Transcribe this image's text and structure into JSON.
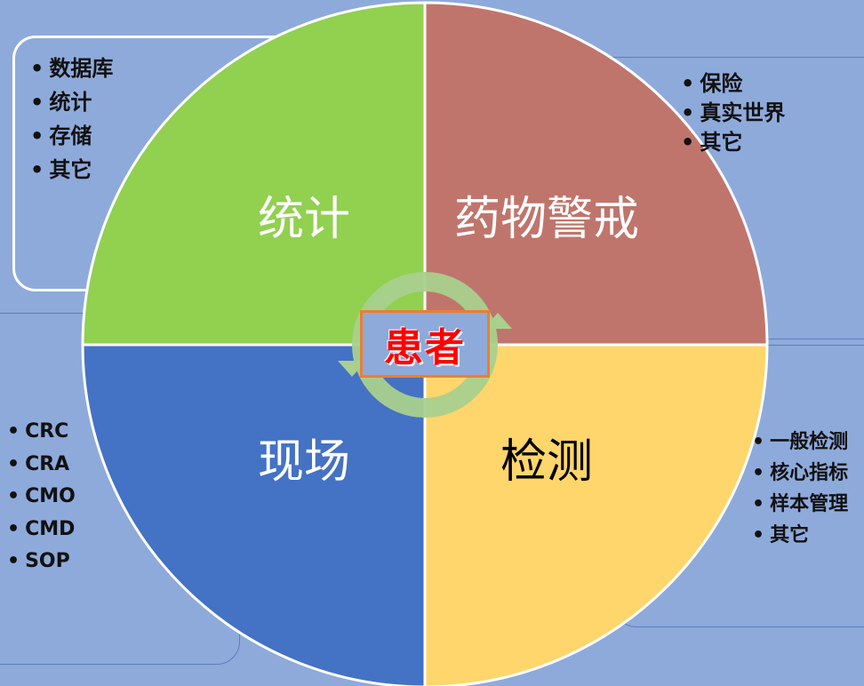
{
  "center": {
    "label": "患者"
  },
  "quadrants": [
    {
      "id": "tl",
      "label": "统计",
      "color": "#92d050",
      "text_color": "#ffffff",
      "items": [
        "数据库",
        "统计",
        "存储",
        "其它"
      ]
    },
    {
      "id": "tr",
      "label": "药物警戒",
      "color": "#c0756c",
      "text_color": "#ffffff",
      "items": [
        "保险",
        "真实世界",
        "其它"
      ]
    },
    {
      "id": "bl",
      "label": "现场",
      "color": "#4472c4",
      "text_color": "#ffffff",
      "items": [
        "CRC",
        "CRA",
        "CMO",
        "CMD",
        "SOP"
      ]
    },
    {
      "id": "br",
      "label": "检测",
      "color": "#ffd66b",
      "text_color": "#000000",
      "items": [
        "一般检测",
        "核心指标",
        "样本管理",
        "其它"
      ]
    }
  ],
  "colors": {
    "background": "#8eaadb",
    "cycle_arrow": "#a9d08e",
    "center_border": "#ed7d31",
    "center_text": "#ff0000"
  }
}
